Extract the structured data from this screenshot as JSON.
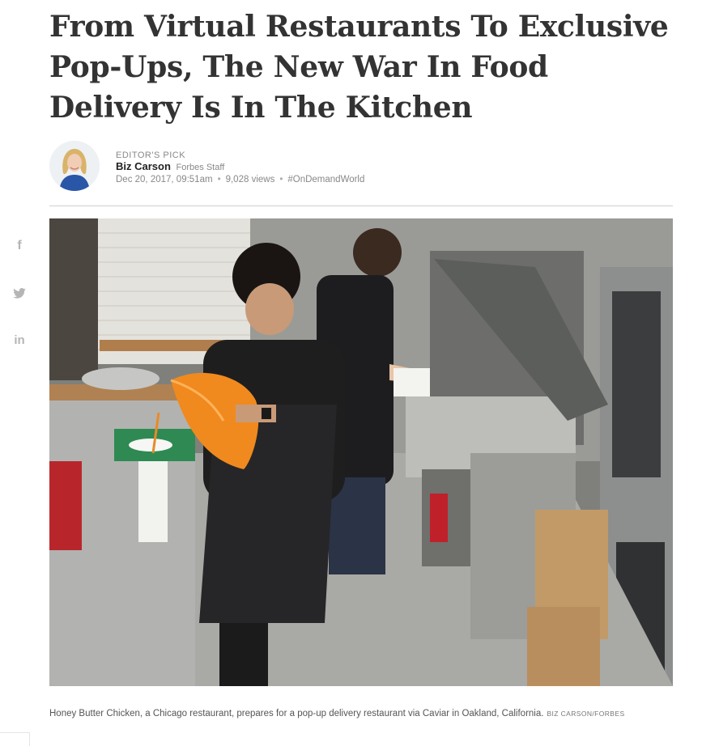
{
  "article": {
    "headline": "From Virtual Restaurants To Exclusive Pop-Ups, The New War In Food Delivery Is In The Kitchen",
    "kicker": "EDITOR'S PICK",
    "author": "Biz Carson",
    "author_role": "Forbes Staff",
    "date": "Dec 20, 2017, 09:51am",
    "views": "9,028 views",
    "hashtag": "#OnDemandWorld",
    "caption": "Honey Butter Chicken, a Chicago restaurant, prepares for a pop-up delivery restaurant via Caviar in Oakland, California.",
    "credit": "BIZ CARSON/FORBES"
  },
  "social": [
    {
      "icon": "facebook-icon",
      "glyph": "f"
    },
    {
      "icon": "twitter-icon"
    },
    {
      "icon": "linkedin-icon",
      "glyph": "in"
    }
  ],
  "colors": {
    "headline": "#333333",
    "meta": "#888888",
    "social_icon": "#b5b5b5",
    "rule": "#cfcfcf"
  }
}
